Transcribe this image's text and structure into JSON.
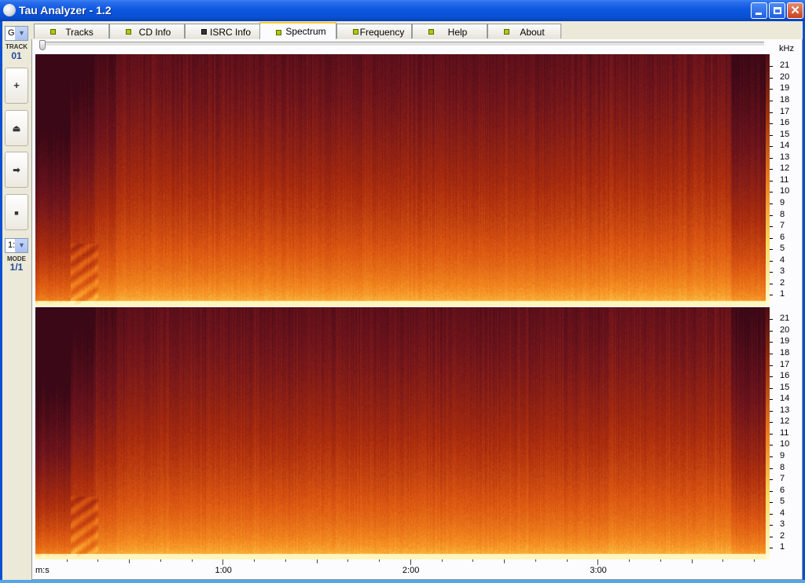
{
  "window": {
    "title": "Tau Analyzer - 1.2"
  },
  "toolbar": {
    "combo_top": "G",
    "track_label": "TRACK",
    "track_number": "01",
    "buttons": [
      {
        "name": "plus-button",
        "glyph": "+"
      },
      {
        "name": "eject-button",
        "glyph": "⏏"
      },
      {
        "name": "play-button",
        "glyph": "➡"
      },
      {
        "name": "stop-button",
        "glyph": "■"
      }
    ],
    "combo_bottom": "1:",
    "mode_label": "MODE",
    "mode_value": "1/1"
  },
  "tabs": [
    {
      "label": "Tracks",
      "active": false,
      "led": "green"
    },
    {
      "label": "CD Info",
      "active": false,
      "led": "green"
    },
    {
      "label": "ISRC Info",
      "active": false,
      "led": "dark"
    },
    {
      "label": "Spectrum",
      "active": true,
      "led": "green"
    },
    {
      "label": "Frequency",
      "active": false,
      "led": "green"
    },
    {
      "label": "Help",
      "active": false,
      "led": "green"
    },
    {
      "label": "About",
      "active": false,
      "led": "green"
    }
  ],
  "spectrum": {
    "freq_unit": "kHz",
    "freq_ticks": [
      1,
      2,
      3,
      4,
      5,
      6,
      7,
      8,
      9,
      10,
      11,
      12,
      13,
      14,
      15,
      16,
      17,
      18,
      19,
      20,
      21
    ],
    "time_unit": "m:s",
    "time_labels": [
      "1:00",
      "2:00",
      "3:00"
    ],
    "duration_seconds": 234,
    "channels": 2
  }
}
